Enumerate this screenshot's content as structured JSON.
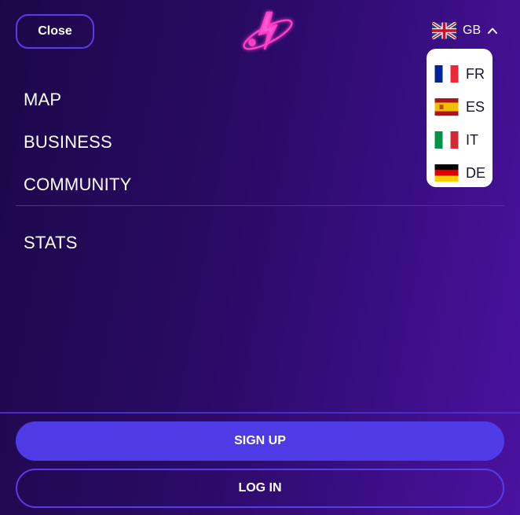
{
  "header": {
    "close_label": "Close",
    "logo_icon": "lightning-orbit-logo",
    "accent_color": "#ff3ec8"
  },
  "language": {
    "current": {
      "code": "GB",
      "flag": "uk-flag-icon"
    },
    "options": [
      {
        "code": "FR",
        "flag": "france-flag-icon"
      },
      {
        "code": "ES",
        "flag": "spain-flag-icon"
      },
      {
        "code": "IT",
        "flag": "italy-flag-icon"
      },
      {
        "code": "DE",
        "flag": "germany-flag-icon"
      }
    ],
    "expanded": true
  },
  "nav": {
    "items": [
      {
        "label": "MAP"
      },
      {
        "label": "BUSINESS"
      },
      {
        "label": "COMMUNITY"
      },
      {
        "label": "STATS"
      }
    ]
  },
  "actions": {
    "signup_label": "SIGN UP",
    "login_label": "LOG IN"
  },
  "colors": {
    "primary_button": "#4f3be6",
    "outline": "#5a3ce6"
  }
}
